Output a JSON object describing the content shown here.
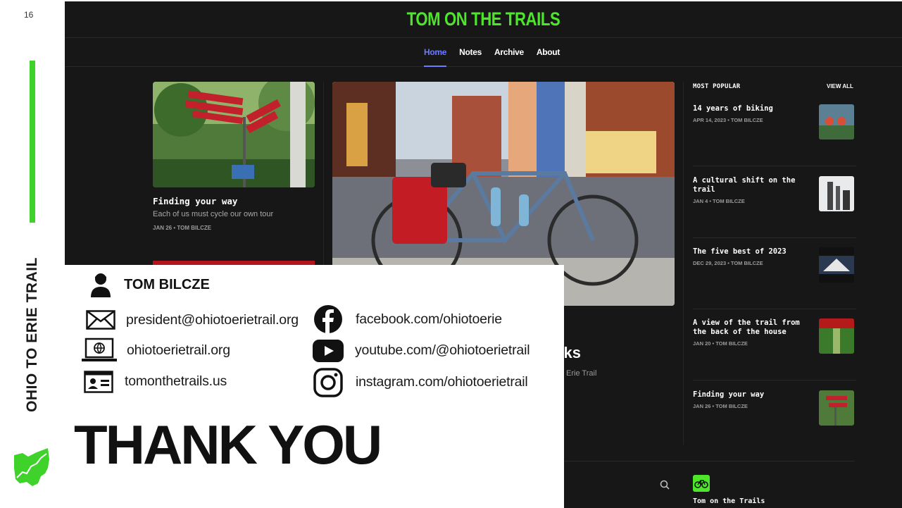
{
  "slide": {
    "number": "16",
    "vertical_title": "OHIO TO ERIE TRAIL",
    "accent_color": "#3ed22a"
  },
  "site": {
    "title": "TOM ON THE TRAILS",
    "brand_color": "#4ee62b",
    "nav": [
      {
        "label": "Home",
        "active": true
      },
      {
        "label": "Notes",
        "active": false
      },
      {
        "label": "Archive",
        "active": false
      },
      {
        "label": "About",
        "active": false
      }
    ],
    "left_card": {
      "title": "Finding your way",
      "subtitle": "Each of us must cycle our own tour",
      "meta": "JAN 26 • TOM BILCZE"
    },
    "main_card": {
      "title_fragment": "rks",
      "subtitle_fragment": "Erie Trail"
    },
    "popular": {
      "heading": "MOST POPULAR",
      "view_all": "VIEW ALL",
      "items": [
        {
          "title": "14 years of biking",
          "meta": "APR 14, 2023 • TOM BILCZE"
        },
        {
          "title": "A cultural shift on the trail",
          "meta": "JAN 4 • TOM BILCZE"
        },
        {
          "title": "The five best of 2023",
          "meta": "DEC 29, 2023 • TOM BILCZE"
        },
        {
          "title": "A view of the trail from the back of the house",
          "meta": "JAN 20 • TOM BILCZE"
        },
        {
          "title": "Finding your way",
          "meta": "JAN 26 • TOM BILCZE"
        }
      ]
    },
    "footer": {
      "name": "Tom on the Trails",
      "search_icon": "search-icon",
      "logo_icon": "bicycle-icon"
    }
  },
  "contact": {
    "name": "TOM BILCZE",
    "email": "president@ohiotoerietrail.org",
    "website": "ohiotoerietrail.org",
    "blog": "tomonthetrails.us",
    "facebook": "facebook.com/ohiotoerie",
    "youtube": "youtube.com/@ohiotoerietrail",
    "instagram": "instagram.com/ohiotoerietrail",
    "closing": "THANK YOU"
  }
}
